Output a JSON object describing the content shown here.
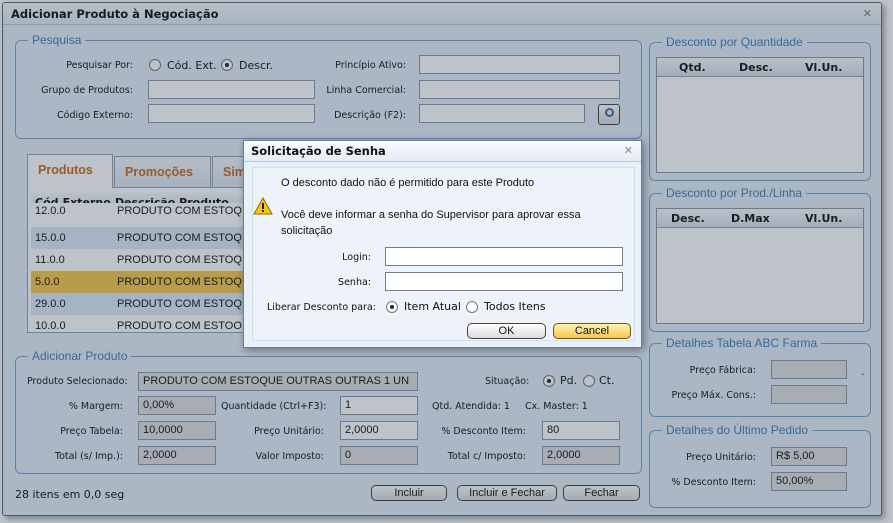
{
  "window": {
    "title": "Adicionar Produto à Negociação"
  },
  "pesquisa": {
    "legend": "Pesquisa",
    "pesquisar_por": "Pesquisar Por:",
    "opt_cod_ext": "Cód. Ext.",
    "opt_descr": "Descr.",
    "grupo_label": "Grupo de Produtos:",
    "codigo_label": "Código Externo:",
    "principio_label": "Princípio Ativo:",
    "linha_label": "Linha Comercial:",
    "descricao_label": "Descrição (F2):"
  },
  "tabs": [
    {
      "label": "Produtos"
    },
    {
      "label": "Promoções"
    },
    {
      "label": "Sim"
    }
  ],
  "products_grid": {
    "headers": [
      "Cód.Externo",
      "Descrição Produto"
    ],
    "rows": [
      {
        "code": "12.0.0",
        "desc": "PRODUTO COM ESTOQ"
      },
      {
        "code": "15.0.0",
        "desc": "PRODUTO COM ESTOQ"
      },
      {
        "code": "11.0.0",
        "desc": "PRODUTO COM ESTOQ"
      },
      {
        "code": "5.0.0",
        "desc": "PRODUTO COM ESTOQ"
      },
      {
        "code": "29.0.0",
        "desc": "PRODUTO COM ESTOQ"
      },
      {
        "code": "10.0.0",
        "desc": "PRODUTO COM ESTOQ"
      }
    ]
  },
  "adicionar": {
    "legend": "Adicionar Produto",
    "produto_label": "Produto Selecionado:",
    "produto_value": "PRODUTO COM ESTOQUE OUTRAS OUTRAS 1 UN",
    "situacao_label": "Situação:",
    "opt_pd": "Pd.",
    "opt_ct": "Ct.",
    "margem_label": "% Margem:",
    "margem_value": "0,00%",
    "qtd_label": "Quantidade (Ctrl+F3):",
    "qtd_value": "1",
    "qtd_atendida": "Qtd. Atendida: 1",
    "cx_master": "Cx. Master: 1",
    "preco_tabela_label": "Preço Tabela:",
    "preco_tabela_value": "10,0000",
    "preco_unit_label": "Preço Unitário:",
    "preco_unit_value": "2,0000",
    "desconto_item_label": "% Desconto Item:",
    "desconto_item_value": "80",
    "total_s_label": "Total (s/ Imp.):",
    "total_s_value": "2,0000",
    "valor_imposto_label": "Valor Imposto:",
    "valor_imposto_value": "0",
    "total_c_label": "Total c/ Imposto:",
    "total_c_value": "2,0000"
  },
  "footer": {
    "status": "28 itens em 0,0 seg",
    "incluir": "Incluir",
    "incluir_fechar": "Incluir e Fechar",
    "fechar": "Fechar"
  },
  "desconto_qtd": {
    "legend": "Desconto por Quantidade",
    "headers": [
      "Qtd.",
      "Desc.",
      "Vl.Un."
    ]
  },
  "desconto_linha": {
    "legend": "Desconto por Prod./Linha",
    "headers": [
      "Desc.",
      "D.Max",
      "Vl.Un."
    ]
  },
  "abc_farma": {
    "legend": "Detalhes Tabela ABC Farma",
    "preco_fabrica": "Preço Fábrica:",
    "preco_max": "Preço Máx. Cons.:",
    "dot": "."
  },
  "ultimo_pedido": {
    "legend": "Detalhes do Último Pedido",
    "preco_unit_label": "Preço Unitário:",
    "preco_unit_value": "R$ 5,00",
    "desconto_label": "% Desconto Item:",
    "desconto_value": "50,00%"
  },
  "dialog": {
    "title": "Solicitação de Senha",
    "message1": "O desconto dado não é permitido para este Produto",
    "message2": "Você deve informar a senha do Supervisor para aprovar essa",
    "message3": "solicitação",
    "login_label": "Login:",
    "senha_label": "Senha:",
    "liberar_label": "Liberar Desconto para:",
    "opt_item_atual": "Item Atual",
    "opt_todos": "Todos Itens",
    "ok": "OK",
    "cancel": "Cancel"
  }
}
